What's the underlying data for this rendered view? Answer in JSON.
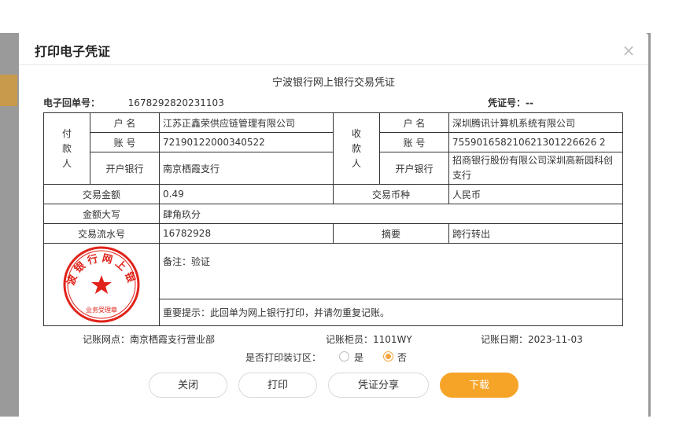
{
  "dialog": {
    "title": "打印电子凭证",
    "close_symbol": "×"
  },
  "voucher": {
    "title": "宁波银行网上银行交易凭证",
    "receipt_label": "电子回单号：",
    "receipt_no": "1678292820231103",
    "voucher_no_label": "凭证号：--",
    "payer": {
      "side_label": [
        "付",
        "款",
        "人"
      ],
      "name_label": "户 名",
      "name": "江苏正鑫荣供应链管理有限公司",
      "account_label": "账 号",
      "account": "72190122000340522",
      "bank_label": "开户银行",
      "bank": "南京栖霞支行"
    },
    "payee": {
      "side_label": [
        "收",
        "款",
        "人"
      ],
      "name_label": "户 名",
      "name": "深圳腾讯计算机系统有限公司",
      "account_label": "账 号",
      "account": "755901658210621301226626 2",
      "bank_label": "开户银行",
      "bank": "招商银行股份有限公司深圳高新园科创支行"
    },
    "amount_label": "交易金额",
    "amount": "0.49",
    "currency_label": "交易币种",
    "currency": "人民币",
    "amount_words_label": "金额大写",
    "amount_words": "肆角玖分",
    "serial_label": "交易流水号",
    "serial": "16782928",
    "summary_label": "摘要",
    "summary": "跨行转出",
    "remark": "备注：验证",
    "notice": "重要提示：此回单为网上银行打印，并请勿重复记账。",
    "seal": {
      "top_text": "宁波银行网上银行",
      "bottom_text": "业务受理章",
      "color": "#e0241b"
    },
    "branch": "记账网点：南京栖霞支行营业部",
    "teller": "记账柜员：1101WY",
    "date": "记账日期：2023-11-03"
  },
  "print_bind": {
    "label": "是否打印装订区：",
    "option_yes": "是",
    "option_no": "否",
    "selected": "否"
  },
  "buttons": {
    "close": "关闭",
    "print": "打印",
    "share": "凭证分享",
    "download": "下载"
  },
  "colors": {
    "accent": "#f6a428",
    "seal": "#e0241b"
  }
}
